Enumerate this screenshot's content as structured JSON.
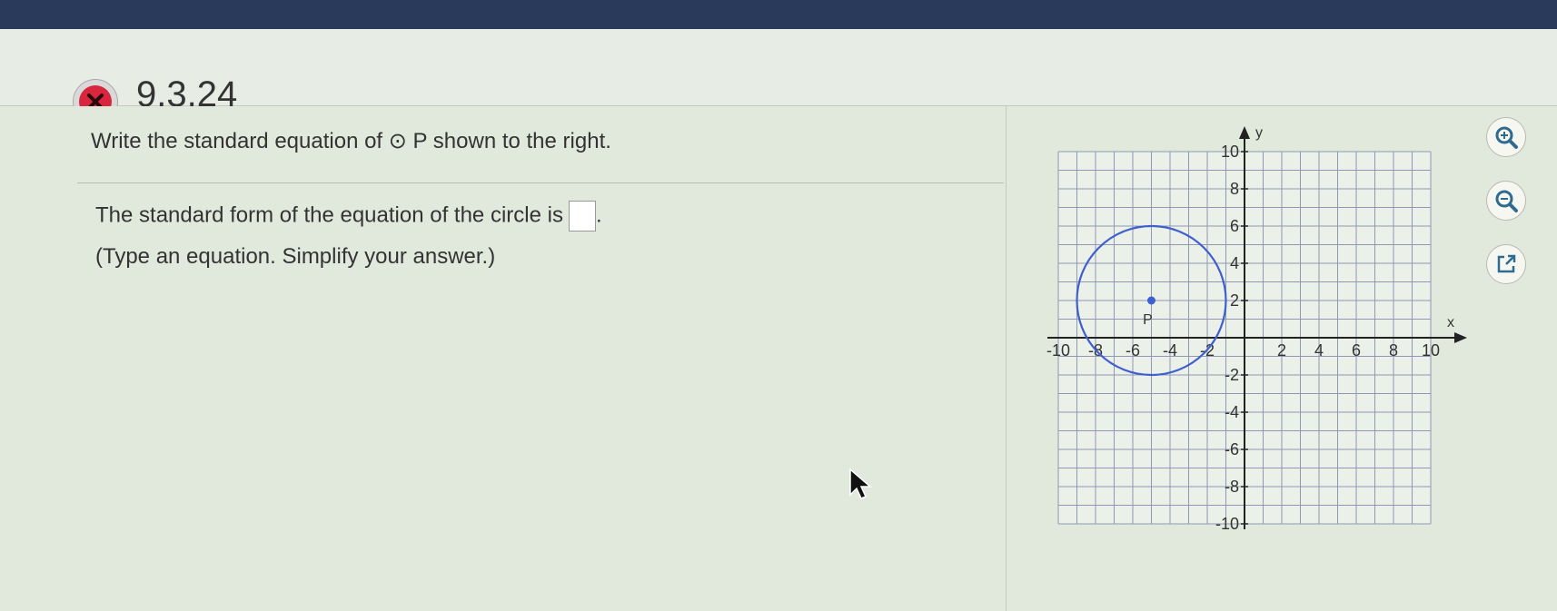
{
  "header": {
    "question_id": "9.3.24",
    "status_icon": "x-circle-icon",
    "status_color": "#d7263d"
  },
  "question": {
    "prompt_before": "Write the standard equation of",
    "circle_symbol": "⊙",
    "prompt_after": "P shown to the right.",
    "answer_prefix": "The standard form of the equation of the circle is",
    "answer_value": "",
    "answer_suffix": ".",
    "hint": "(Type an equation. Simplify your answer.)"
  },
  "graph": {
    "x_axis_label": "x",
    "y_axis_label": "y",
    "x_tick_labels": [
      "-10",
      "-8",
      "-6",
      "-4",
      "-2",
      "2",
      "4",
      "6",
      "8",
      "10"
    ],
    "y_tick_labels": [
      "10",
      "8",
      "6",
      "4",
      "2",
      "-2",
      "-4",
      "-6",
      "-8",
      "-10"
    ],
    "center_label": "P",
    "center": [
      -5,
      2
    ],
    "radius": 4,
    "x_range": [
      -10,
      10
    ],
    "y_range": [
      -10,
      10
    ],
    "circle_color": "#3f5fd0",
    "grid_color": "#8f98b5"
  },
  "tools": {
    "zoom_in": "zoom-in-icon",
    "zoom_out": "zoom-out-icon",
    "popout": "popout-icon"
  }
}
